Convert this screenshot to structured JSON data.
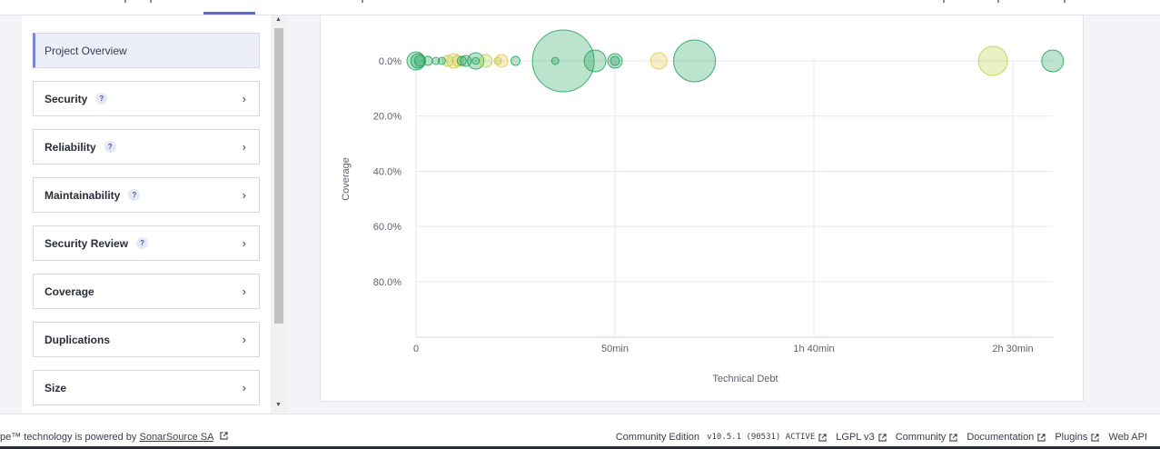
{
  "nav": {
    "items": [
      {
        "label": "Project Overview",
        "active": true,
        "help": false
      },
      {
        "label": "Security",
        "active": false,
        "help": true
      },
      {
        "label": "Reliability",
        "active": false,
        "help": true
      },
      {
        "label": "Maintainability",
        "active": false,
        "help": true
      },
      {
        "label": "Security Review",
        "active": false,
        "help": true
      },
      {
        "label": "Coverage",
        "active": false,
        "help": false
      },
      {
        "label": "Duplications",
        "active": false,
        "help": false
      },
      {
        "label": "Size",
        "active": false,
        "help": false
      }
    ],
    "help_glyph": "?",
    "chevron_glyph": "›"
  },
  "chart_data": {
    "type": "scatter",
    "title": "",
    "xlabel": "Technical Debt",
    "ylabel": "Coverage",
    "x_ticks": [
      {
        "value": 0,
        "label": "0"
      },
      {
        "value": 50,
        "label": "50min"
      },
      {
        "value": 100,
        "label": "1h 40min"
      },
      {
        "value": 150,
        "label": "2h 30min"
      }
    ],
    "y_ticks": [
      {
        "value": 0,
        "label": "0.0%"
      },
      {
        "value": 20,
        "label": "20.0%"
      },
      {
        "value": 40,
        "label": "40.0%"
      },
      {
        "value": 60,
        "label": "60.0%"
      },
      {
        "value": 80,
        "label": "80.0%"
      }
    ],
    "xlim": [
      0,
      160
    ],
    "ylim": [
      0,
      100
    ],
    "y_inverted": true,
    "grid": true,
    "points": [
      {
        "x": 0,
        "y": 0,
        "size": 10,
        "color": "#1fa35a"
      },
      {
        "x": 0.5,
        "y": 0,
        "size": 8,
        "color": "#1fa35a"
      },
      {
        "x": 1,
        "y": 0,
        "size": 6,
        "color": "#1fa35a"
      },
      {
        "x": 3,
        "y": 0,
        "size": 5,
        "color": "#1fa35a"
      },
      {
        "x": 5,
        "y": 0,
        "size": 4,
        "color": "#1fa35a"
      },
      {
        "x": 6.5,
        "y": 0,
        "size": 4,
        "color": "#1fa35a"
      },
      {
        "x": 8,
        "y": 0,
        "size": 6,
        "color": "#b9cf3e"
      },
      {
        "x": 9.5,
        "y": 0,
        "size": 8,
        "color": "#e8c54b"
      },
      {
        "x": 10.5,
        "y": 0,
        "size": 6,
        "color": "#b9cf3e"
      },
      {
        "x": 11.5,
        "y": 0,
        "size": 5,
        "color": "#1fa35a"
      },
      {
        "x": 12.5,
        "y": 0,
        "size": 6,
        "color": "#1fa35a"
      },
      {
        "x": 15,
        "y": 0,
        "size": 9,
        "color": "#1fa35a"
      },
      {
        "x": 15,
        "y": 0,
        "size": 4,
        "color": "#1fa35a"
      },
      {
        "x": 17.5,
        "y": 0,
        "size": 7,
        "color": "#b9cf3e"
      },
      {
        "x": 20.5,
        "y": 0,
        "size": 4,
        "color": "#b9cf3e"
      },
      {
        "x": 21.5,
        "y": 0,
        "size": 7,
        "color": "#e8c54b"
      },
      {
        "x": 25,
        "y": 0,
        "size": 5,
        "color": "#1fa35a"
      },
      {
        "x": 35,
        "y": 0,
        "size": 4,
        "color": "#1fa35a"
      },
      {
        "x": 37,
        "y": 0,
        "size": 34,
        "color": "#1fa35a"
      },
      {
        "x": 45,
        "y": 0,
        "size": 12,
        "color": "#1fa35a"
      },
      {
        "x": 50,
        "y": 0,
        "size": 8,
        "color": "#1fa35a"
      },
      {
        "x": 50,
        "y": 0,
        "size": 5,
        "color": "#1fa35a"
      },
      {
        "x": 61,
        "y": 0,
        "size": 9,
        "color": "#e8c54b"
      },
      {
        "x": 70,
        "y": 0,
        "size": 23,
        "color": "#1fa35a"
      },
      {
        "x": 145,
        "y": 0,
        "size": 16,
        "color": "#b9cf3e"
      },
      {
        "x": 160,
        "y": 0,
        "size": 12,
        "color": "#1fa35a"
      }
    ]
  },
  "footer": {
    "left_prefix": "pe™ technology is powered by ",
    "left_link": "SonarSource SA",
    "edition": "Community Edition",
    "version": "v10.5.1 (90531) ACTIVE",
    "license": "LGPL v3",
    "community": "Community",
    "documentation": "Documentation",
    "plugins": "Plugins",
    "webapi": "Web API"
  }
}
